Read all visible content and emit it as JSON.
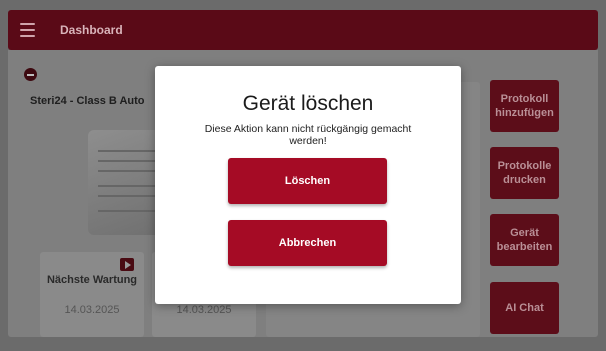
{
  "header": {
    "title": "Dashboard",
    "menu_icon": "hamburger-menu-icon"
  },
  "device": {
    "title": "Steri24 - Class B Auto"
  },
  "cards": {
    "maintenance": {
      "label": "Nächste Wartung",
      "date": "14.03.2025"
    },
    "second": {
      "date": "14.03.2025"
    }
  },
  "sidebar": {
    "buttons": [
      "Protokoll hinzufügen",
      "Protokolle drucken",
      "Gerät bearbeiten",
      "AI Chat"
    ]
  },
  "dialog": {
    "title": "Gerät löschen",
    "message": "Diese Aktion kann nicht rückgängig gemacht werden!",
    "confirm_label": "Löschen",
    "cancel_label": "Abbrechen"
  },
  "colors": {
    "accent": "#a50b25",
    "header": "#5a0a17"
  }
}
